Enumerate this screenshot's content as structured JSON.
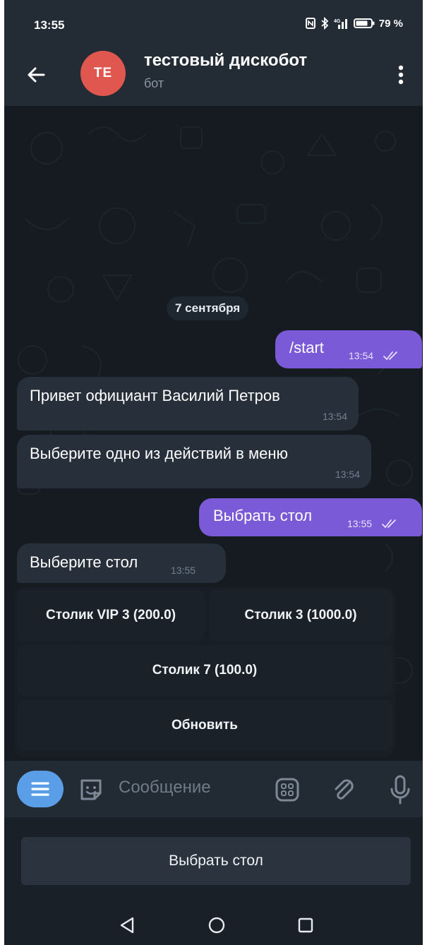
{
  "status_bar": {
    "time": "13:55",
    "battery": "79 %",
    "icons": [
      "nfc-icon",
      "bluetooth-icon",
      "signal-icon",
      "battery-icon"
    ]
  },
  "header": {
    "avatar_initials": "TE",
    "title": "тестовый дискобот",
    "subtitle": "бот",
    "avatar_color": "#e0574f"
  },
  "chat": {
    "date": "7 сентября",
    "messages": [
      {
        "direction": "out",
        "text": "/start",
        "time": "13:54"
      },
      {
        "direction": "in",
        "text": "Привет официант Василий Петров",
        "time": "13:54"
      },
      {
        "direction": "in",
        "text": "Выберите одно из действий в меню",
        "time": "13:54"
      },
      {
        "direction": "out",
        "text": "Выбрать стол",
        "time": "13:55"
      },
      {
        "direction": "in",
        "text": "Выберите стол",
        "time": "13:55"
      }
    ],
    "inline_keyboard": [
      "Столик VIP 3 (200.0)",
      "Столик 3 (1000.0)",
      "Столик 7 (100.0)",
      "Обновить"
    ]
  },
  "input": {
    "placeholder": "Сообщение"
  },
  "reply_keyboard": {
    "button": "Выбрать стол"
  },
  "colors": {
    "outgoing_bubble": "#7a5ad6",
    "incoming_bubble": "#262f3a",
    "menu_button": "#5b9ee8"
  }
}
